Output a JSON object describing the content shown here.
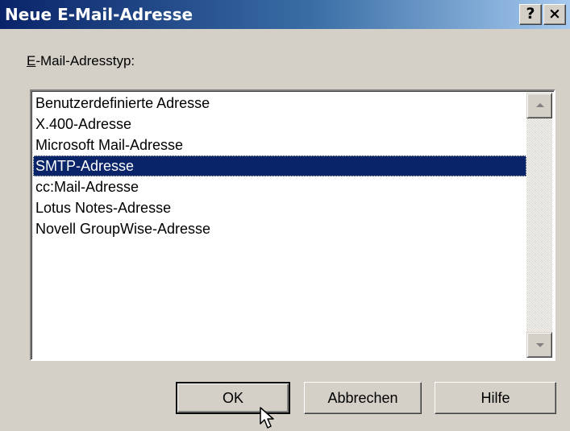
{
  "window": {
    "title": "Neue E-Mail-Adresse",
    "help_button": "?",
    "close_button": "×"
  },
  "address_type": {
    "label_accel": "E",
    "label_rest": "-Mail-Adresstyp:",
    "items": [
      "Benutzerdefinierte Adresse",
      "X.400-Adresse",
      "Microsoft Mail-Adresse",
      "SMTP-Adresse",
      "cc:Mail-Adresse",
      "Lotus Notes-Adresse",
      "Novell GroupWise-Adresse"
    ],
    "selected": "SMTP-Adresse"
  },
  "buttons": {
    "ok": "OK",
    "cancel": "Abbrechen",
    "help": "Hilfe"
  },
  "colors": {
    "selection": "#0a246a",
    "face": "#d4d0c8"
  }
}
